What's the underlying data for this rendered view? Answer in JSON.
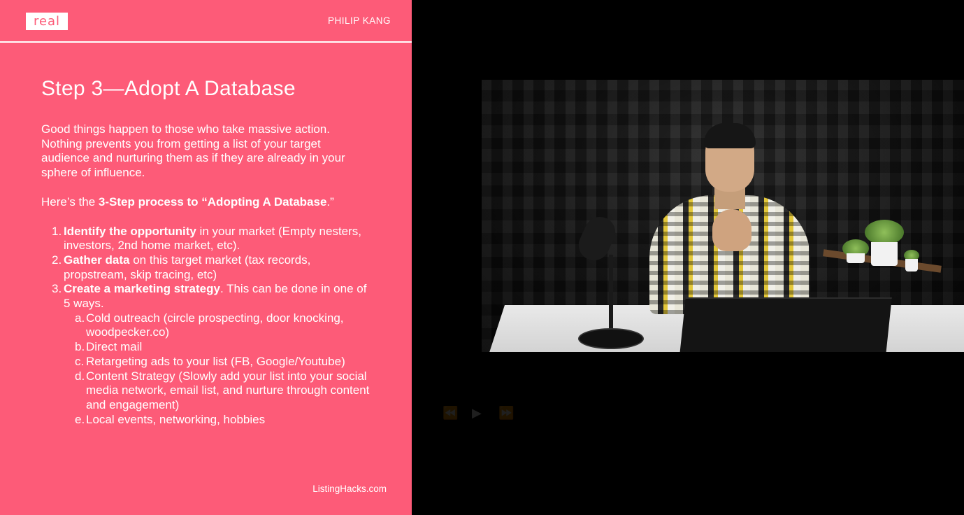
{
  "slide": {
    "logo_text": "real",
    "author": "PHILIP KANG",
    "title": "Step 3—Adopt A Database",
    "intro": "Good things happen to those who take massive action. Nothing prevents you from getting a list of your target audience and nurturing them as if they are already in your sphere of influence.",
    "process_prefix": "Here’s the ",
    "process_bold": "3-Step process to “Adopting A Database",
    "process_suffix": ".”",
    "steps": [
      {
        "num": "1.",
        "bold": "Identify the opportunity",
        "rest": " in your market (Empty nesters, investors, 2nd home market, etc)."
      },
      {
        "num": "2.",
        "bold": "Gather data",
        "rest": " on this target market (tax records, propstream, skip tracing, etc)"
      },
      {
        "num": "3.",
        "bold": "Create a marketing strategy",
        "rest": ". This can be done in one of 5 ways."
      }
    ],
    "substeps": [
      {
        "letter": "a.",
        "text": "Cold outreach (circle prospecting, door knocking, woodpecker.co)"
      },
      {
        "letter": "b.",
        "text": "Direct mail"
      },
      {
        "letter": "c.",
        "text": "Retargeting ads to your list (FB, Google/Youtube)"
      },
      {
        "letter": "d.",
        "text": "Content Strategy (Slowly add your list into your social media network, email list, and nurture through content and engagement)"
      },
      {
        "letter": "e.",
        "text": "Local events, networking, hobbies"
      }
    ],
    "footer": "ListingHacks.com"
  },
  "colors": {
    "slide_bg": "#fd5b78",
    "page_bg": "#000000"
  },
  "controls": {
    "rewind_icon": "⏪",
    "play_icon": "▶",
    "forward_icon": "⏩"
  }
}
